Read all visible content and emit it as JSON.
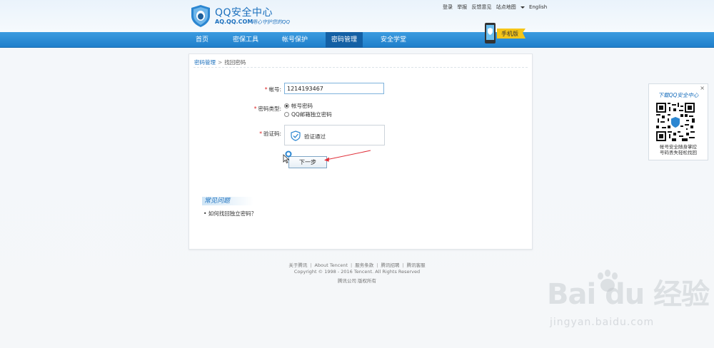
{
  "header": {
    "title": "QQ安全中心",
    "domain": "AQ.QQ.COM",
    "slogan": "用心守护您的QQ",
    "top_links": [
      "登录",
      "举报",
      "反馈意见",
      "站点地图"
    ],
    "lang_link": "English"
  },
  "nav": {
    "items": [
      {
        "label": "首页"
      },
      {
        "label": "密保工具"
      },
      {
        "label": "帐号保护"
      },
      {
        "label": "密码管理",
        "active": true
      },
      {
        "label": "安全学堂"
      }
    ],
    "promo_text": "手机版"
  },
  "breadcrumb": {
    "parent": "密码管理",
    "separator": ">",
    "current": "找回密码"
  },
  "form": {
    "account_label": "帐号:",
    "account_value": "1214193467",
    "type_label": "密码类型:",
    "type_options": [
      {
        "label": "帐号密码",
        "checked": true
      },
      {
        "label": "QQ邮箱独立密码",
        "checked": false
      }
    ],
    "captcha_label": "验证码:",
    "captcha_status": "验证通过",
    "next_button": "下一步",
    "required_mark": "*"
  },
  "faq": {
    "title": "常见问题",
    "items": [
      "• 如何找回独立密码？"
    ]
  },
  "qr_widget": {
    "close": "×",
    "title": "下载QQ安全中心",
    "caption_line1": "帐号安全随身掌控",
    "caption_line2": "号码丢失轻松找回"
  },
  "footer": {
    "links": [
      "关于腾讯",
      "About Tencent",
      "服务条款",
      "腾讯招聘",
      "腾讯客服"
    ],
    "link_separator": "|",
    "copyright": "Copyright © 1998 - 2016 Tencent. All Rights Reserved",
    "rights": "腾讯公司 版权所有"
  },
  "watermark": {
    "logo": "Bai du 经验",
    "url": "jingyan.baidu.com"
  },
  "colors": {
    "brand_blue": "#1a6fbd",
    "nav_blue": "#2a8bd6",
    "nav_active": "#1460a5",
    "required_red": "#dd2222",
    "annotation_red": "#e0303a"
  }
}
